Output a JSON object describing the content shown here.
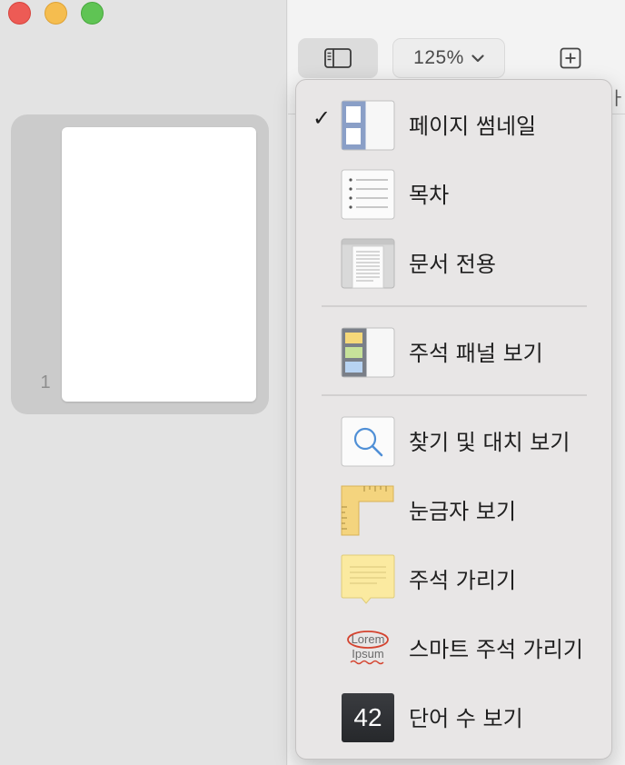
{
  "window": {
    "traffic_lights": [
      "close",
      "minimize",
      "zoom"
    ]
  },
  "sidebar": {
    "thumbnails": [
      {
        "page_number": "1",
        "selected": true
      }
    ]
  },
  "toolbar": {
    "view_button_icon": "sidebar-icon",
    "zoom_label": "125%",
    "zoom_icon": "chevron-down-icon",
    "add_icon": "plus-square-icon",
    "peek_text": "ㅏ"
  },
  "menu": {
    "items": [
      {
        "label": "페이지 썸네일",
        "icon": "page-thumbnails-icon",
        "checked": true
      },
      {
        "label": "목차",
        "icon": "table-of-contents-icon",
        "checked": false
      },
      {
        "label": "문서 전용",
        "icon": "document-only-icon",
        "checked": false
      },
      {
        "label": "주석 패널 보기",
        "icon": "comments-panel-icon",
        "checked": false
      },
      {
        "label": "찾기 및 대치 보기",
        "icon": "search-icon",
        "checked": false
      },
      {
        "label": "눈금자 보기",
        "icon": "ruler-icon",
        "checked": false
      },
      {
        "label": "주석 가리기",
        "icon": "comment-note-icon",
        "checked": false
      },
      {
        "label": "스마트 주석 가리기",
        "icon": "smart-annotation-icon",
        "checked": false
      },
      {
        "label": "단어 수 보기",
        "icon": "word-count-icon",
        "checked": false
      }
    ],
    "check_mark": "✓",
    "smart_annotation_icon_text": [
      "Lorem",
      "Ipsum"
    ],
    "word_count_icon_text": "42"
  },
  "colors": {
    "close": "#ed5b55",
    "minimize": "#f5bd4f",
    "zoom": "#5fc454",
    "menu_bg": "#e8e6e6",
    "sidebar_bg": "#e3e3e3"
  }
}
